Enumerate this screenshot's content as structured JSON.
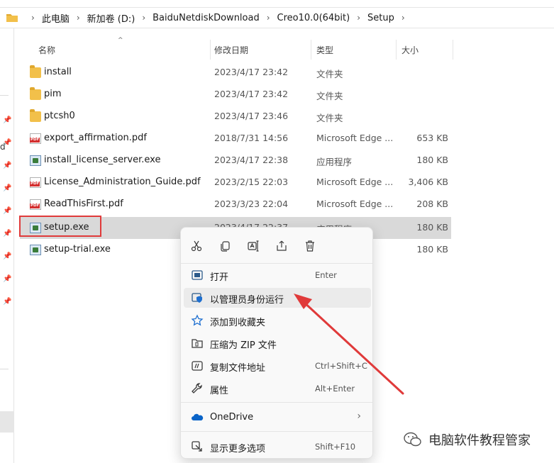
{
  "breadcrumb": [
    {
      "label": "此电脑"
    },
    {
      "label": "新加卷 (D:)"
    },
    {
      "label": "BaiduNetdiskDownload"
    },
    {
      "label": "Creo10.0(64bit)"
    },
    {
      "label": "Setup"
    }
  ],
  "leftnav": {
    "truncated_char": "d"
  },
  "columns": {
    "name": "名称",
    "date": "修改日期",
    "type": "类型",
    "size": "大小"
  },
  "files": [
    {
      "name": "install",
      "date": "2023/4/17 23:42",
      "type": "文件夹",
      "size": "",
      "icon": "folder-icon"
    },
    {
      "name": "pim",
      "date": "2023/4/17 23:42",
      "type": "文件夹",
      "size": "",
      "icon": "folder-icon"
    },
    {
      "name": "ptcsh0",
      "date": "2023/4/17 23:46",
      "type": "文件夹",
      "size": "",
      "icon": "folder-icon"
    },
    {
      "name": "export_affirmation.pdf",
      "date": "2018/7/31 14:56",
      "type": "Microsoft Edge ...",
      "size": "653 KB",
      "icon": "pdf-icon"
    },
    {
      "name": "install_license_server.exe",
      "date": "2023/4/17 22:38",
      "type": "应用程序",
      "size": "180 KB",
      "icon": "exe-icon"
    },
    {
      "name": "License_Administration_Guide.pdf",
      "date": "2023/2/15 22:03",
      "type": "Microsoft Edge ...",
      "size": "3,406 KB",
      "icon": "pdf-icon"
    },
    {
      "name": "ReadThisFirst.pdf",
      "date": "2023/3/23 22:04",
      "type": "Microsoft Edge ...",
      "size": "208 KB",
      "icon": "pdf-icon"
    },
    {
      "name": "setup.exe",
      "date": "2023/4/17 22:37",
      "type": "应用程序",
      "size": "180 KB",
      "icon": "exe-icon",
      "selected": true
    },
    {
      "name": "setup-trial.exe",
      "date": "",
      "type": "",
      "size": "180 KB",
      "icon": "exe-icon"
    }
  ],
  "context_menu": {
    "quick_actions": [
      "cut-icon",
      "copy-icon",
      "rename-icon",
      "share-icon",
      "delete-icon"
    ],
    "items": [
      {
        "label": "打开",
        "shortcut": "Enter",
        "icon": "open-icon"
      },
      {
        "label": "以管理员身份运行",
        "shortcut": "",
        "icon": "shield-icon",
        "hover": true
      },
      {
        "label": "添加到收藏夹",
        "shortcut": "",
        "icon": "star-icon"
      },
      {
        "label": "压缩为 ZIP 文件",
        "shortcut": "",
        "icon": "zip-icon"
      },
      {
        "label": "复制文件地址",
        "shortcut": "Ctrl+Shift+C",
        "icon": "copy-path-icon"
      },
      {
        "label": "属性",
        "shortcut": "Alt+Enter",
        "icon": "wrench-icon"
      },
      {
        "label": "OneDrive",
        "shortcut": "",
        "icon": "cloud-icon",
        "submenu": true
      },
      {
        "label": "显示更多选项",
        "shortcut": "Shift+F10",
        "icon": "more-options-icon"
      }
    ]
  },
  "watermark": {
    "text": "电脑软件教程管家"
  },
  "colors": {
    "annotation": "#e03a3a",
    "selection": "#d9d9d9",
    "menu_hover": "#ebebeb",
    "accent": "#0067c0"
  }
}
